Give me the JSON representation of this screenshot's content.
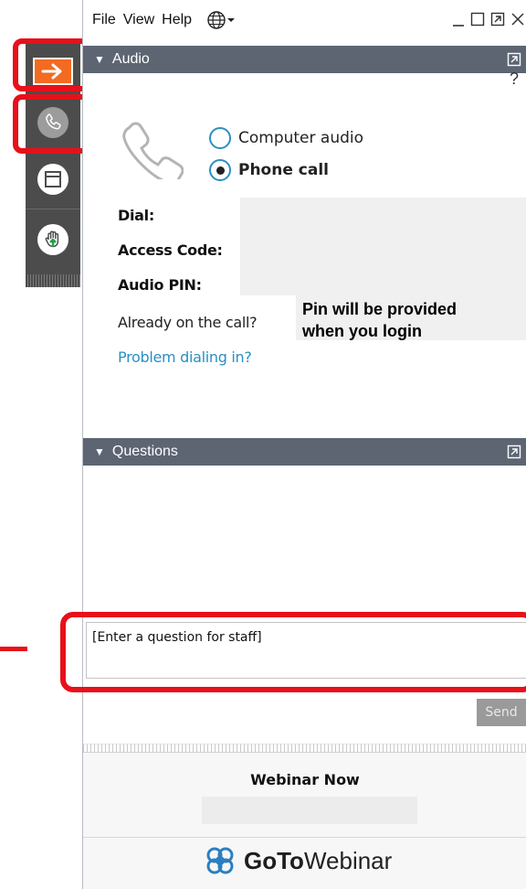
{
  "menu": {
    "file": "File",
    "view": "View",
    "help": "Help"
  },
  "audio": {
    "title": "Audio",
    "help": "?",
    "option_computer": "Computer audio",
    "option_phone": "Phone call",
    "selected": "Phone call",
    "dial_label": "Dial:",
    "access_code_label": "Access Code:",
    "audio_pin_label": "Audio PIN:",
    "pin_note_line1": "Pin will be provided",
    "pin_note_line2": "when you login",
    "already_on_call": "Already on the call?",
    "problem_link": "Problem dialing in?"
  },
  "questions": {
    "title": "Questions",
    "input_text": "[Enter a question for staff]",
    "send_label": "Send"
  },
  "footer": {
    "webinar_title": "Webinar Now",
    "brand_bold": "GoTo",
    "brand_regular": "Webinar"
  },
  "colors": {
    "accent_orange": "#f26b21",
    "highlight_red": "#e8101a",
    "header_bg": "#5d6573",
    "link_blue": "#2a8fc4",
    "brand_blue": "#2b7fc1"
  },
  "icons": {
    "strip": [
      "arrow-right-icon",
      "phone-icon",
      "window-icon",
      "raise-hand-icon"
    ],
    "audio": "phone-handset-icon",
    "brand": "gotowebinar-logo-icon"
  }
}
